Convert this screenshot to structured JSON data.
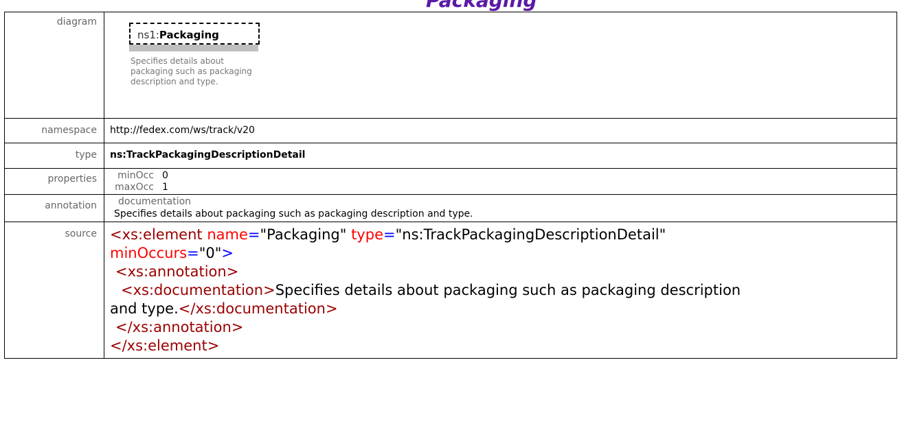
{
  "header": {
    "title": "Packaging"
  },
  "rows": {
    "diagram": {
      "label": "diagram",
      "node_prefix": "ns1:",
      "node_name": "Packaging",
      "doc_line1": "Specifies details about",
      "doc_line2": "packaging such as packaging",
      "doc_line3": "description and type."
    },
    "namespace": {
      "label": "namespace",
      "value": "http://fedex.com/ws/track/v20"
    },
    "type": {
      "label": "type",
      "value": "ns:TrackPackagingDescriptionDetail"
    },
    "properties": {
      "label": "properties",
      "items": [
        {
          "key": "minOcc",
          "value": "0"
        },
        {
          "key": "maxOcc",
          "value": "1"
        }
      ]
    },
    "annotation": {
      "label": "annotation",
      "sub_label": "documentation",
      "text": "Specifies details about packaging such as packaging description and type."
    },
    "source": {
      "label": "source",
      "l1_open": "<xs:element ",
      "l1_attr1": "name",
      "l1_eq1": "=",
      "l1_val1": "\"Packaging\" ",
      "l1_attr2": "type",
      "l1_eq2": "=",
      "l1_val2": "\"ns:TrackPackagingDescriptionDetail\"",
      "l2_attr": "minOccurs",
      "l2_eq": "=",
      "l2_val": "\"0\"",
      "l2_close": ">",
      "l3": "<xs:annotation>",
      "l4_open": "<xs:documentation>",
      "l4_text": "Specifies details about packaging such as packaging description",
      "l5_text": "and type.",
      "l5_close": "</xs:documentation>",
      "l6": "</xs:annotation>",
      "l7": "</xs:element>"
    }
  }
}
